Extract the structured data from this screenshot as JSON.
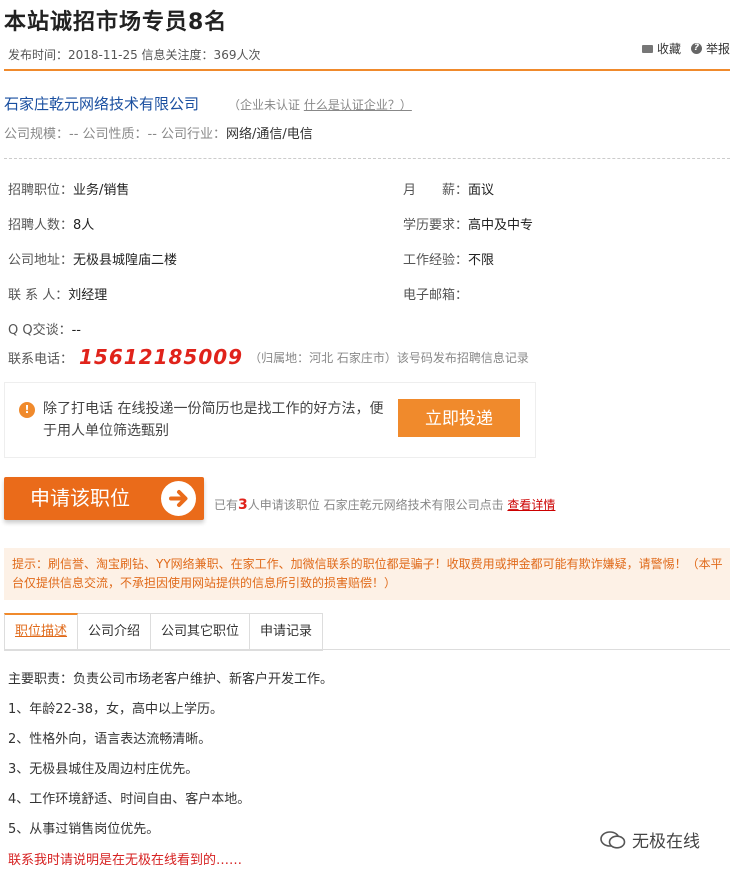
{
  "header": {
    "title": "本站诚招市场专员8名",
    "meta": "发布时间：2018-11-25 信息关注度：369人次",
    "favorite_label": "收藏",
    "report_label": "举报"
  },
  "company": {
    "name": "石家庄乾元网络技术有限公司",
    "cert_status": "（企业未认证",
    "cert_link": "什么是认证企业？）",
    "scale_prefix": "公司规模：-- 公司性质：-- 公司行业：",
    "industry": "网络/通信/电信"
  },
  "job": {
    "position_label": "招聘职位：",
    "position": "业务/销售",
    "salary_label": "月　　薪：",
    "salary": "面议",
    "count_label": "招聘人数：",
    "count": "8人",
    "education_label": "学历要求：",
    "education": "高中及中专",
    "address_label": "公司地址：",
    "address": "无极县城隍庙二楼",
    "experience_label": "工作经验：",
    "experience": "不限",
    "contact_label": "联 系 人：",
    "contact": "刘经理",
    "email_label": "电子邮箱：",
    "email": "",
    "qq_label": "Q Q交谈：",
    "qq": "--",
    "phone_label": "联系电话：",
    "phone": "15612185009",
    "phone_note": "（归属地：河北 石家庄市）该号码发布招聘信息记录"
  },
  "tip": {
    "text": "除了打电话 在线投递一份简历也是找工作的好方法，便于用人单位筛选甄别",
    "button": "立即投递"
  },
  "apply": {
    "button": "申请该职位",
    "note_prefix": "已有",
    "count": "3",
    "note_suffix": "人申请该职位 石家庄乾元网络技术有限公司点击",
    "detail_link": "查看详情"
  },
  "warning": "提示：刷信誉、淘宝刷钻、YY网络兼职、在家工作、加微信联系的职位都是骗子！收取费用或押金都可能有欺诈嫌疑，请警惕！（本平台仅提供信息交流，不承担因使用网站提供的信息所引致的损害赔偿！）",
  "tabs": [
    "职位描述",
    "公司介绍",
    "公司其它职位",
    "申请记录"
  ],
  "description": [
    "主要职责：负责公司市场老客户维护、新客户开发工作。",
    "1、年龄22-38，女，高中以上学历。",
    "2、性格外向，语言表达流畅清晰。",
    "3、无极县城住及周边村庄优先。",
    "4、工作环境舒适、时间自由、客户本地。",
    "5、从事过销售岗位优先。"
  ],
  "final_note": "联系我时请说明是在无极在线看到的……",
  "watermark": "无极在线",
  "colors": {
    "accent": "#f08a2c",
    "link": "#1a4fa0",
    "alert": "#e0231b"
  }
}
